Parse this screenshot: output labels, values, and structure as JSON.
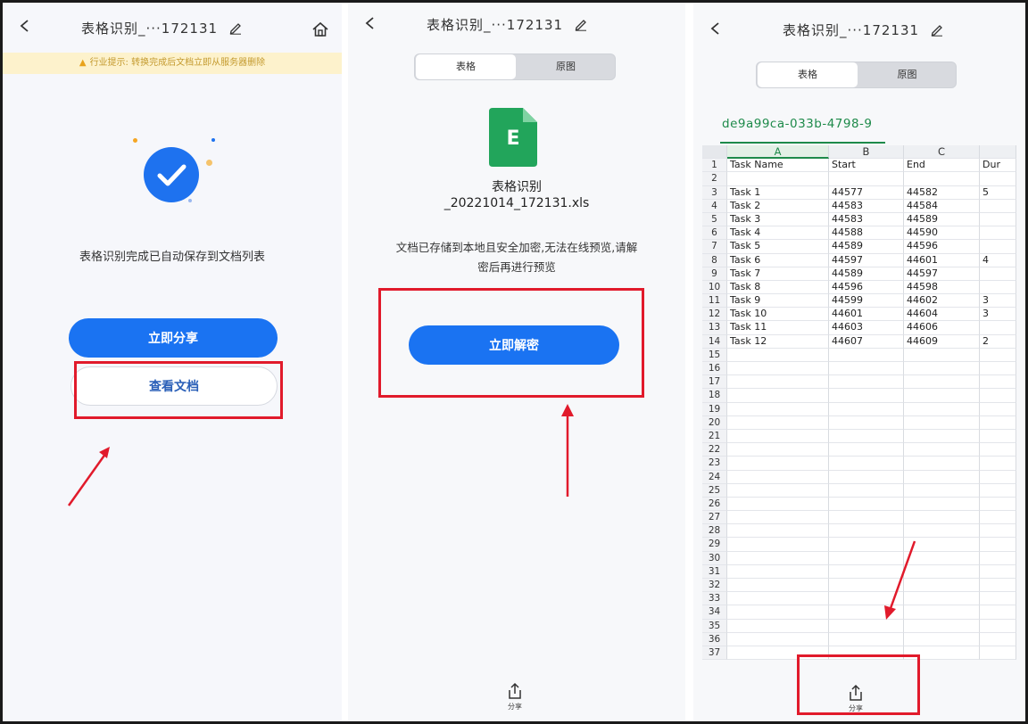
{
  "panel1": {
    "title": "表格识别_···172131",
    "notice": "行业提示: 转换完成后文档立即从服务器删除",
    "done_text": "表格识别完成已自动保存到文档列表",
    "share_now": "立即分享",
    "view_doc": "查看文档"
  },
  "panel2": {
    "title": "表格识别_···172131",
    "tab_table": "表格",
    "tab_original": "原图",
    "file_icon_letter": "E",
    "file_name_line1": "表格识别",
    "file_name_line2": "_20221014_172131.xls",
    "lock_msg_line1": "文档已存储到本地且安全加密,无法在线预览,请解",
    "lock_msg_line2": "密后再进行预览",
    "decrypt_now": "立即解密",
    "share_label": "分享"
  },
  "panel3": {
    "title": "表格识别_···172131",
    "tab_table": "表格",
    "tab_original": "原图",
    "sheet_name": "de9a99ca-033b-4798-9",
    "columns": [
      "A",
      "B",
      "C",
      ""
    ],
    "rows": [
      [
        "1",
        "Task Name",
        "Start",
        "End",
        "Dur"
      ],
      [
        "2",
        "",
        "",
        "",
        ""
      ],
      [
        "3",
        "Task 1",
        "44577",
        "44582",
        "5"
      ],
      [
        "4",
        "Task 2",
        "44583",
        "44584",
        ""
      ],
      [
        "5",
        "Task 3",
        "44583",
        "44589",
        ""
      ],
      [
        "6",
        "Task 4",
        "44588",
        "44590",
        ""
      ],
      [
        "7",
        "Task 5",
        "44589",
        "44596",
        ""
      ],
      [
        "8",
        "Task 6",
        "44597",
        "44601",
        "4"
      ],
      [
        "9",
        "Task 7",
        "44589",
        "44597",
        ""
      ],
      [
        "10",
        "Task 8",
        "44596",
        "44598",
        ""
      ],
      [
        "11",
        "Task 9",
        "44599",
        "44602",
        "3"
      ],
      [
        "12",
        "Task 10",
        "44601",
        "44604",
        "3"
      ],
      [
        "13",
        "Task 11",
        "44603",
        "44606",
        ""
      ],
      [
        "14",
        "Task 12",
        "44607",
        "44609",
        "2"
      ],
      [
        "15",
        "",
        "",
        "",
        ""
      ],
      [
        "16",
        "",
        "",
        "",
        ""
      ],
      [
        "17",
        "",
        "",
        "",
        ""
      ],
      [
        "18",
        "",
        "",
        "",
        ""
      ],
      [
        "19",
        "",
        "",
        "",
        ""
      ],
      [
        "20",
        "",
        "",
        "",
        ""
      ],
      [
        "21",
        "",
        "",
        "",
        ""
      ],
      [
        "22",
        "",
        "",
        "",
        ""
      ],
      [
        "23",
        "",
        "",
        "",
        ""
      ],
      [
        "24",
        "",
        "",
        "",
        ""
      ],
      [
        "25",
        "",
        "",
        "",
        ""
      ],
      [
        "26",
        "",
        "",
        "",
        ""
      ],
      [
        "27",
        "",
        "",
        "",
        ""
      ],
      [
        "28",
        "",
        "",
        "",
        ""
      ],
      [
        "29",
        "",
        "",
        "",
        ""
      ],
      [
        "30",
        "",
        "",
        "",
        ""
      ],
      [
        "31",
        "",
        "",
        "",
        ""
      ],
      [
        "32",
        "",
        "",
        "",
        ""
      ],
      [
        "33",
        "",
        "",
        "",
        ""
      ],
      [
        "34",
        "",
        "",
        "",
        ""
      ],
      [
        "35",
        "",
        "",
        "",
        ""
      ],
      [
        "36",
        "",
        "",
        "",
        ""
      ],
      [
        "37",
        "",
        "",
        "",
        ""
      ]
    ],
    "share_label": "分享"
  },
  "colors": {
    "primary_blue": "#1a73f2",
    "highlight_red": "#e11a2b",
    "excel_green": "#1e8a4a",
    "notice_bg": "#fdf2cc"
  }
}
